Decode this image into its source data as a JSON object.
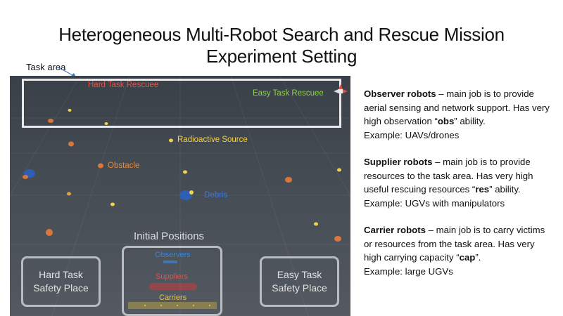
{
  "title": {
    "line1": "Heterogeneous Multi-Robot Search and Rescue Mission",
    "line2": "Experiment Setting"
  },
  "task_area_label": "Task area",
  "scene": {
    "hard_rescuee": "Hard Task Rescuee",
    "easy_rescuee": "Easy Task Rescuee",
    "radioactive": "Radioactive Source",
    "obstacle": "Obstacle",
    "debris": "Debris",
    "initial_positions": "Initial Positions",
    "observers": "Observers",
    "suppliers": "Suppliers",
    "carriers": "Carriers",
    "hard_safety_line1": "Hard Task",
    "hard_safety_line2": "Safety Place",
    "easy_safety_line1": "Easy Task",
    "easy_safety_line2": "Safety Place",
    "colors": {
      "rescuee_hard": "#e0534a",
      "rescuee_easy": "#8fd14f",
      "radioactive": "#f2d34a",
      "obstacle": "#e48a3a",
      "debris": "#3a78e0"
    }
  },
  "descriptions": [
    {
      "heading": "Observer robots",
      "text_before": " – main job is to provide aerial sensing and network support. Has very high observation “",
      "keyword": "obs",
      "text_after": "” ability.",
      "example": "Example: UAVs/drones"
    },
    {
      "heading": "Supplier robots",
      "text_before": " – main job is to provide resources to the task area. Has very high useful rescuing resources “",
      "keyword": "res",
      "text_after": "” ability.",
      "example": "Example: UGVs with manipulators"
    },
    {
      "heading": "Carrier robots",
      "text_before": " – main job is to carry victims or resources from the task area. Has very high carrying capacity “",
      "keyword": "cap",
      "text_after": "”.",
      "example": "Example: large UGVs"
    }
  ]
}
